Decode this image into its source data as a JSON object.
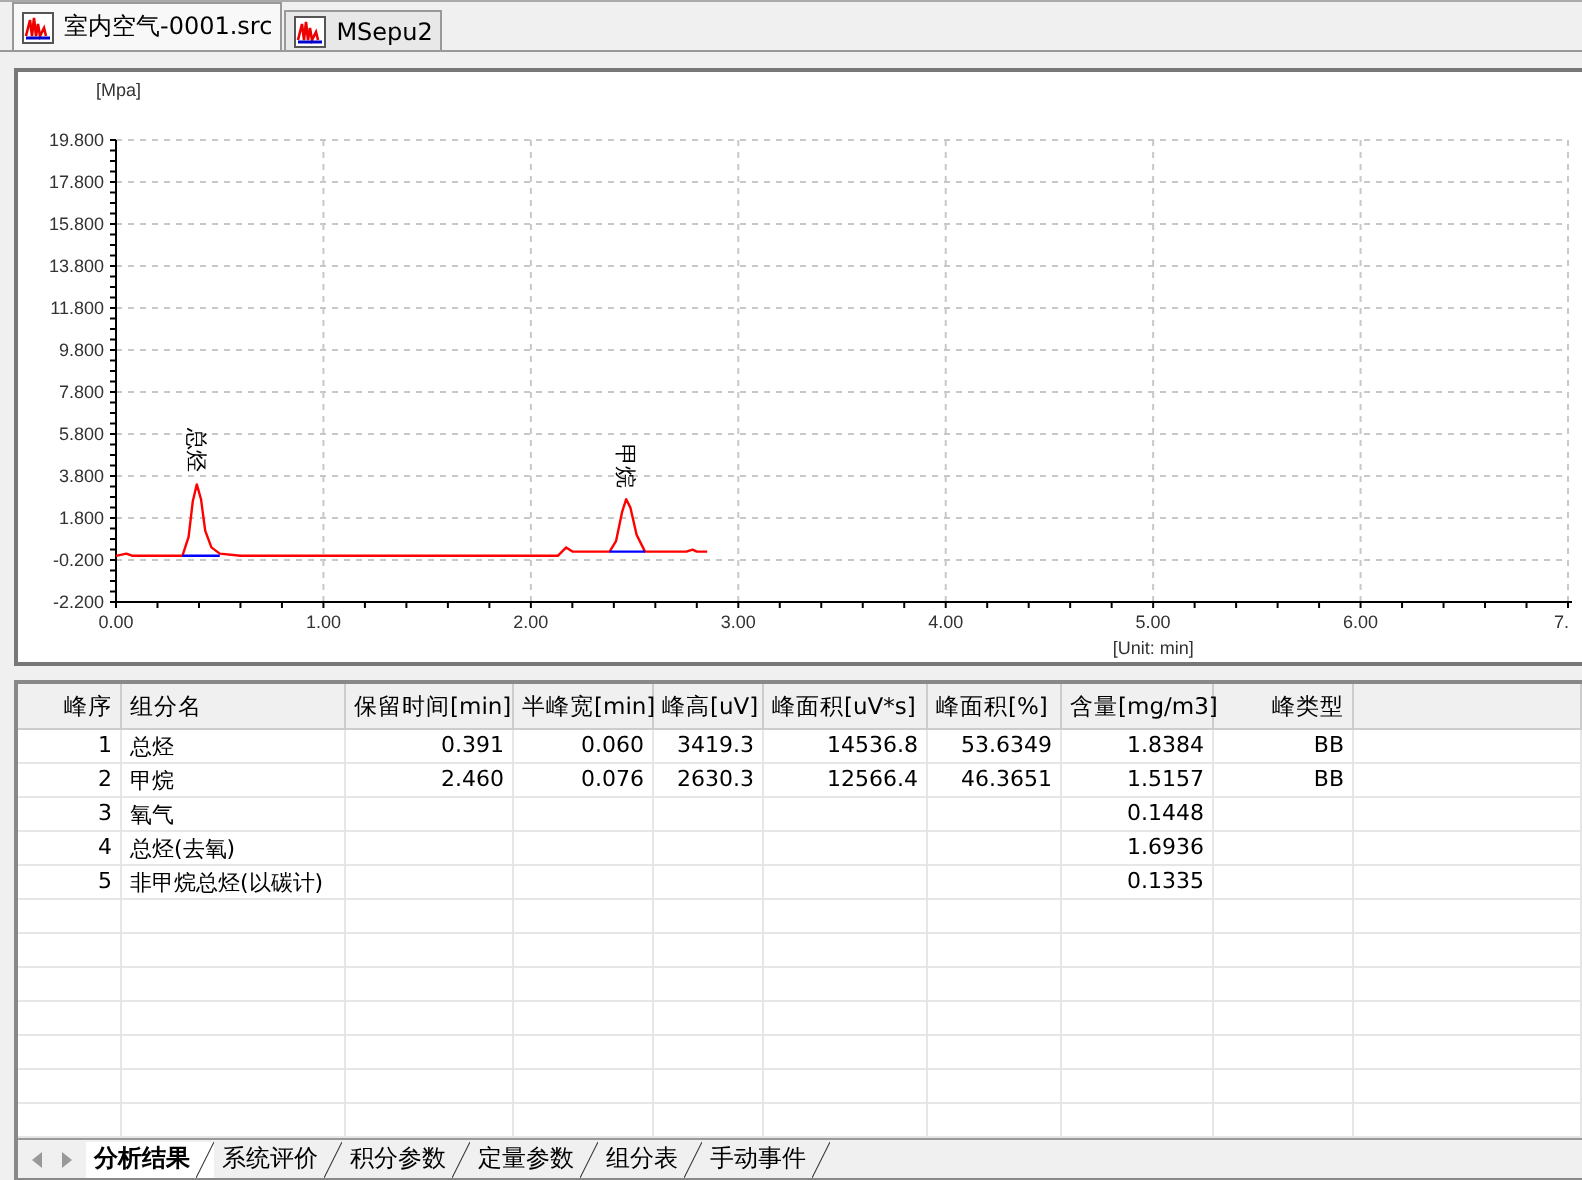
{
  "doc_tabs": [
    {
      "label": "室内空气-0001.src",
      "selected": true
    },
    {
      "label": "MSepu2",
      "selected": false
    }
  ],
  "chart": {
    "chart_data": {
      "type": "line",
      "ylabel": "[Mpa]",
      "xlabel": "[Unit: min]",
      "xlim": [
        0,
        7
      ],
      "ylim": [
        -2.2,
        19.8
      ],
      "xticks": [
        {
          "value": 0,
          "label": "0.00"
        },
        {
          "value": 1,
          "label": "1.00"
        },
        {
          "value": 2,
          "label": "2.00"
        },
        {
          "value": 3,
          "label": "3.00"
        },
        {
          "value": 4,
          "label": "4.00"
        },
        {
          "value": 5,
          "label": "5.00"
        },
        {
          "value": 6,
          "label": "6.00"
        },
        {
          "value": 7,
          "label": "7."
        }
      ],
      "yticks": [
        {
          "value": 19.8,
          "label": "19.800"
        },
        {
          "value": 17.8,
          "label": "17.800"
        },
        {
          "value": 15.8,
          "label": "15.800"
        },
        {
          "value": 13.8,
          "label": "13.800"
        },
        {
          "value": 11.8,
          "label": "11.800"
        },
        {
          "value": 9.8,
          "label": "9.800"
        },
        {
          "value": 7.8,
          "label": "7.800"
        },
        {
          "value": 5.8,
          "label": "5.800"
        },
        {
          "value": 3.8,
          "label": "3.800"
        },
        {
          "value": 1.8,
          "label": "1.800"
        },
        {
          "value": -0.2,
          "label": "-0.200"
        },
        {
          "value": -2.2,
          "label": "-2.200"
        }
      ],
      "x": [
        0,
        0.05,
        0.08,
        0.2,
        0.32,
        0.35,
        0.37,
        0.39,
        0.41,
        0.43,
        0.46,
        0.5,
        0.6,
        1.5,
        2.13,
        2.17,
        2.2,
        2.23,
        2.38,
        2.41,
        2.44,
        2.46,
        2.48,
        2.51,
        2.55,
        2.75,
        2.78,
        2.8,
        2.85
      ],
      "series": [
        {
          "color": "#ff0000",
          "values": [
            0,
            0.1,
            0,
            0,
            0,
            0.9,
            2.6,
            3.4,
            2.7,
            1.2,
            0.4,
            0.1,
            0,
            0,
            0,
            0.4,
            0.2,
            0.2,
            0.2,
            0.7,
            2.1,
            2.7,
            2.3,
            1.0,
            0.2,
            0.2,
            0.3,
            0.2,
            0.2
          ]
        },
        {
          "color": "#0000ff",
          "values": [
            null,
            null,
            null,
            null,
            0,
            0,
            0,
            0,
            0,
            0,
            0,
            0,
            null,
            null,
            null,
            null,
            null,
            null,
            0.2,
            0.2,
            0.2,
            0.2,
            0.2,
            0.2,
            0.2,
            null,
            null,
            null,
            null
          ]
        }
      ],
      "grid": true,
      "annotations": [
        {
          "x": 0.391,
          "y": 3.4,
          "text": "总烃"
        },
        {
          "x": 2.46,
          "y": 2.65,
          "text": "甲烷"
        }
      ]
    }
  },
  "table": {
    "columns": [
      "峰序",
      "组分名",
      "保留时间[min]",
      "半峰宽[min]",
      "峰高[uV]",
      "峰面积[uV*s]",
      "峰面积[%]",
      "含量[mg/m3]",
      "峰类型"
    ],
    "rows": [
      [
        "1",
        "总烃",
        "0.391",
        "0.060",
        "3419.3",
        "14536.8",
        "53.6349",
        "1.8384",
        "BB"
      ],
      [
        "2",
        "甲烷",
        "2.460",
        "0.076",
        "2630.3",
        "12566.4",
        "46.3651",
        "1.5157",
        "BB"
      ],
      [
        "3",
        "氧气",
        "",
        "",
        "",
        "",
        "",
        "0.1448",
        ""
      ],
      [
        "4",
        "总烃(去氧)",
        "",
        "",
        "",
        "",
        "",
        "1.6936",
        ""
      ],
      [
        "5",
        "非甲烷总烃(以碳计)",
        "",
        "",
        "",
        "",
        "",
        "0.1335",
        ""
      ]
    ]
  },
  "sheet_tabs": [
    {
      "label": "分析结果",
      "selected": true
    },
    {
      "label": "系统评价",
      "selected": false
    },
    {
      "label": "积分参数",
      "selected": false
    },
    {
      "label": "定量参数",
      "selected": false
    },
    {
      "label": "组分表",
      "selected": false
    },
    {
      "label": "手动事件",
      "selected": false
    }
  ]
}
